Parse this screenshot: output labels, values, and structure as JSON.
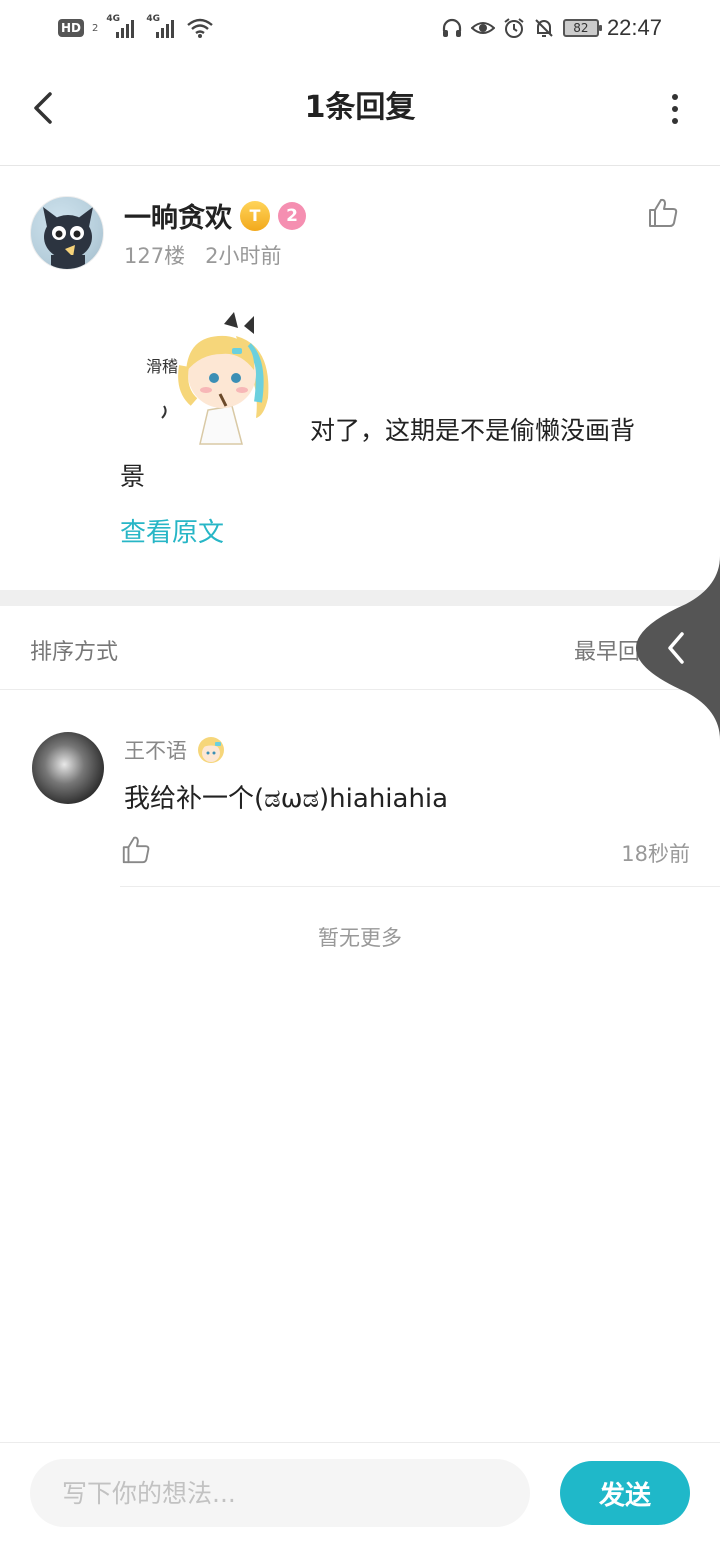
{
  "status_bar": {
    "hd_label": "HD",
    "hd_sub": "2",
    "net1": "4G",
    "net2": "4G",
    "battery": "82",
    "time": "22:47"
  },
  "header": {
    "title": "1条回复"
  },
  "post": {
    "username": "一晌贪欢",
    "badge_t": "T",
    "level": "2",
    "floor": "127楼",
    "time_ago": "2小时前",
    "sticker_text": "滑稽",
    "text_line1": "对了，这期是不是偷懒没画背",
    "text_line2": "景",
    "view_original": "查看原文"
  },
  "sort": {
    "label": "排序方式",
    "value": "最早回复"
  },
  "replies": [
    {
      "username": "王不语",
      "text": "我给补一个(ಡωಡ)hiahiahia",
      "time": "18秒前"
    }
  ],
  "no_more": "暂无更多",
  "composer": {
    "placeholder": "写下你的想法...",
    "send_label": "发送"
  },
  "colors": {
    "accent": "#1fb8c9",
    "link": "#27b6c6",
    "level_badge": "#f58fb1",
    "t_badge": "#f2a91c"
  }
}
